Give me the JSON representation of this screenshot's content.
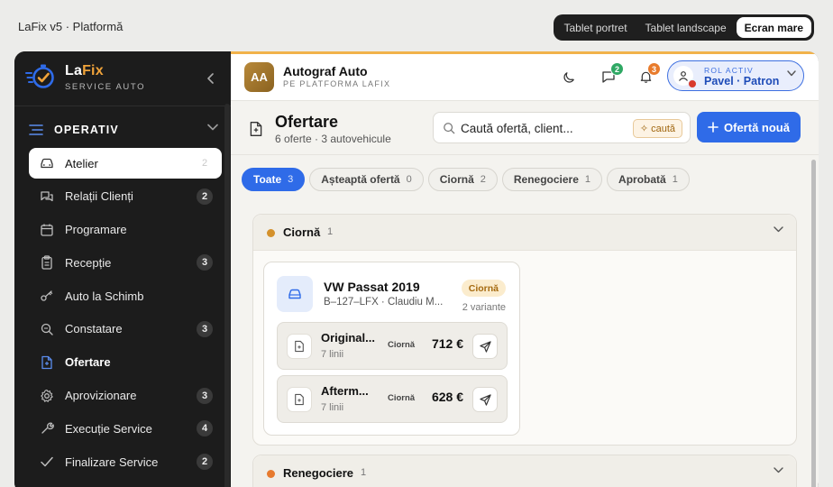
{
  "app": {
    "title": "LaFix v5 · Platformă"
  },
  "view_switch": {
    "options": [
      "Tablet portret",
      "Tablet landscape",
      "Ecran mare"
    ],
    "active_index": 2
  },
  "brand": {
    "name_part1": "La",
    "name_part2": "Fix",
    "subtitle": "SERVICE AUTO"
  },
  "sidebar": {
    "section_label": "OPERATIV",
    "items": [
      {
        "label": "Atelier",
        "badge": "2",
        "icon": "car-icon"
      },
      {
        "label": "Relații Clienți",
        "badge": "2",
        "icon": "chat-icon"
      },
      {
        "label": "Programare",
        "badge": "",
        "icon": "calendar-icon"
      },
      {
        "label": "Recepție",
        "badge": "3",
        "icon": "clipboard-icon"
      },
      {
        "label": "Auto la Schimb",
        "badge": "",
        "icon": "key-icon"
      },
      {
        "label": "Constatare",
        "badge": "3",
        "icon": "search-icon"
      },
      {
        "label": "Ofertare",
        "badge": "",
        "icon": "document-icon"
      },
      {
        "label": "Aprovizionare",
        "badge": "3",
        "icon": "gear-icon"
      },
      {
        "label": "Execuție Service",
        "badge": "4",
        "icon": "wrench-icon"
      },
      {
        "label": "Finalizare Service",
        "badge": "2",
        "icon": "check-icon"
      }
    ]
  },
  "header": {
    "company_initials": "AA",
    "company_name": "Autograf Auto",
    "company_sub": "PE PLATFORMA LAFIX",
    "messages_badge": "2",
    "notifications_badge": "3",
    "role_label": "ROL ACTIV",
    "role_name": "Pavel · Patron"
  },
  "page": {
    "title": "Ofertare",
    "subtitle": "6 oferte · 3 autovehicule",
    "search_placeholder": "Caută ofertă, client...",
    "search_button": "caută",
    "new_button": "Ofertă nouă"
  },
  "tabs": [
    {
      "label": "Toate",
      "count": "3"
    },
    {
      "label": "Așteaptă ofertă",
      "count": "0"
    },
    {
      "label": "Ciornă",
      "count": "2"
    },
    {
      "label": "Renegociere",
      "count": "1"
    },
    {
      "label": "Aprobată",
      "count": "1"
    }
  ],
  "groups": [
    {
      "label": "Ciornă",
      "count": "1",
      "dot_color": "#d4912c",
      "card": {
        "title": "VW Passat 2019",
        "subtitle": "B–127–LFX · Claudiu M...",
        "status": "Ciornă",
        "variant_count": "2 variante",
        "variants": [
          {
            "name": "Original...",
            "lines": "7 linii",
            "status": "Ciornă",
            "price": "712 €"
          },
          {
            "name": "Afterm...",
            "lines": "7 linii",
            "status": "Ciornă",
            "price": "628 €"
          }
        ]
      }
    },
    {
      "label": "Renegociere",
      "count": "1",
      "dot_color": "#e77a2e"
    }
  ],
  "colors": {
    "accent": "#2f6be8",
    "brand_orange": "#f0a33a",
    "badge_green": "#2fa864",
    "badge_orange": "#e87b2c"
  }
}
